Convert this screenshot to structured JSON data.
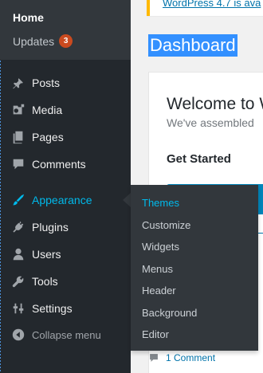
{
  "sidebar": {
    "dashboard_sub": {
      "home": "Home",
      "updates": "Updates",
      "updates_count": "3"
    },
    "items": [
      {
        "label": "Posts"
      },
      {
        "label": "Media"
      },
      {
        "label": "Pages"
      },
      {
        "label": "Comments"
      },
      {
        "label": "Appearance"
      },
      {
        "label": "Plugins"
      },
      {
        "label": "Users"
      },
      {
        "label": "Tools"
      },
      {
        "label": "Settings"
      }
    ],
    "collapse_label": "Collapse menu"
  },
  "flyout": {
    "items": [
      "Themes",
      "Customize",
      "Widgets",
      "Menus",
      "Header",
      "Background",
      "Editor"
    ]
  },
  "content": {
    "notice_link": "WordPress 4.7 is ava",
    "page_title": "Dashboard",
    "welcome_heading": "Welcome to W",
    "welcome_sub": "We've assembled",
    "get_started": "Get Started",
    "activity_link": "1 Comment"
  },
  "colors": {
    "sidebar_bg": "#23282d",
    "flyout_bg": "#32373c",
    "accent": "#00b9eb",
    "badge": "#ca4a1f",
    "selection": "#3390ff"
  }
}
